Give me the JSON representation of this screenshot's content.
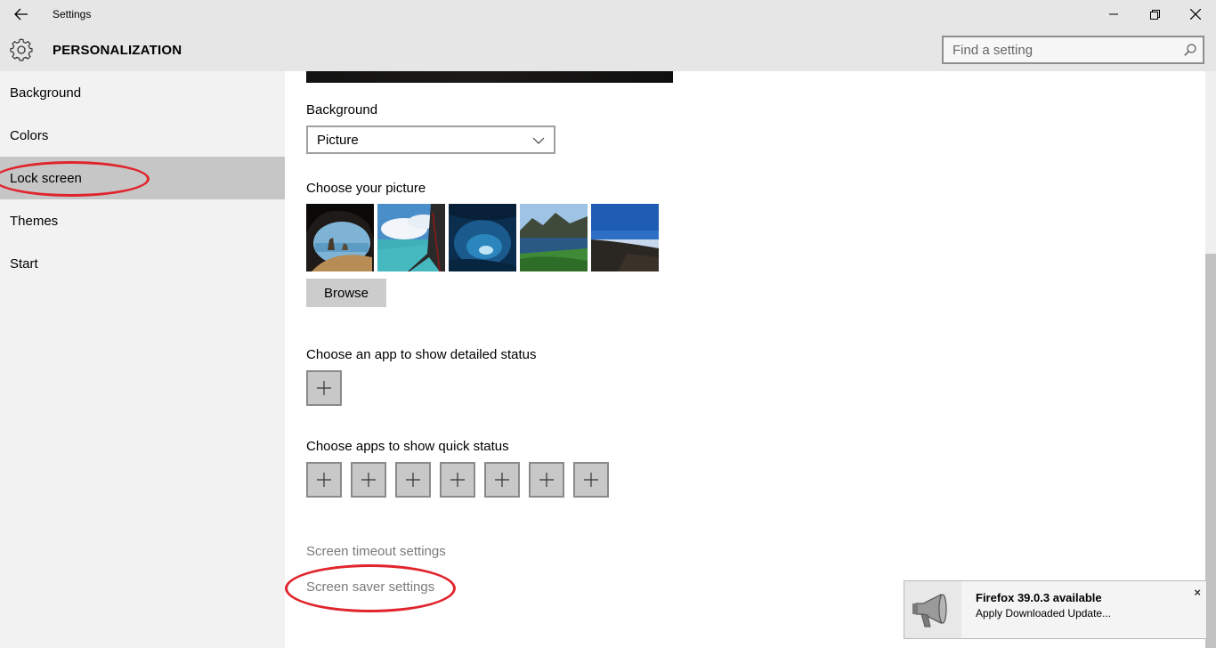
{
  "titlebar": {
    "title": "Settings"
  },
  "header": {
    "title": "PERSONALIZATION"
  },
  "search": {
    "placeholder": "Find a setting"
  },
  "sidebar": {
    "items": [
      {
        "label": "Background",
        "active": false
      },
      {
        "label": "Colors",
        "active": false
      },
      {
        "label": "Lock screen",
        "active": true
      },
      {
        "label": "Themes",
        "active": false
      },
      {
        "label": "Start",
        "active": false
      }
    ]
  },
  "content": {
    "background_label": "Background",
    "background_value": "Picture",
    "choose_picture_label": "Choose your picture",
    "browse_label": "Browse",
    "detailed_status_label": "Choose an app to show detailed status",
    "quick_status_label": "Choose apps to show quick status",
    "screen_timeout_link": "Screen timeout settings",
    "screen_saver_link": "Screen saver settings"
  },
  "toast": {
    "title": "Firefox 39.0.3 available",
    "body": "Apply Downloaded Update...",
    "close": "×"
  },
  "colors": {
    "annotation": "#e0242c",
    "selected_nav": "#c6c6c6",
    "chrome": "#e6e6e6"
  }
}
